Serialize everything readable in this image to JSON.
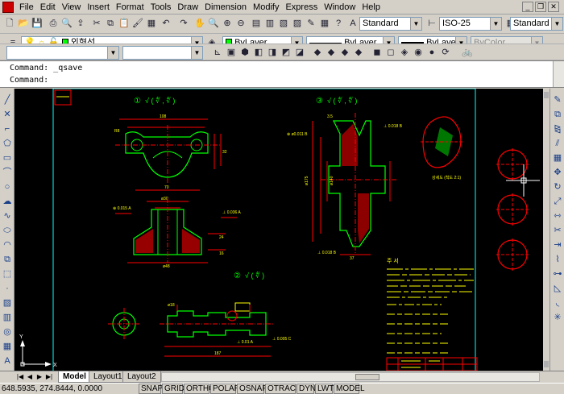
{
  "menu": {
    "items": [
      {
        "label": "File"
      },
      {
        "label": "Edit"
      },
      {
        "label": "View"
      },
      {
        "label": "Insert"
      },
      {
        "label": "Format"
      },
      {
        "label": "Tools"
      },
      {
        "label": "Draw"
      },
      {
        "label": "Dimension"
      },
      {
        "label": "Modify"
      },
      {
        "label": "Express"
      },
      {
        "label": "Window"
      },
      {
        "label": "Help"
      }
    ]
  },
  "styles": {
    "text_style": "Standard",
    "dim_style": "ISO-25",
    "table_style": "Standard"
  },
  "layers": {
    "current_layer": "외형선",
    "color": "ByLayer",
    "linetype": "ByLayer",
    "lineweight": "ByLayer",
    "plot_style": "ByColor"
  },
  "command": {
    "line1": "Command: _qsave",
    "line2": "Command:"
  },
  "drawing": {
    "view1_label": "①",
    "view2_label": "②",
    "view3_label": "③",
    "notes_title": "주 서",
    "grid_colors": {
      "outline": "#00ff00",
      "dimension": "#ff0000",
      "center": "#ff0000",
      "text": "#ffff00",
      "border": "#00ffff"
    }
  },
  "tabs": {
    "model": "Model",
    "layout1": "Layout1",
    "layout2": "Layout2"
  },
  "status": {
    "coords": "648.5935, 274.8444, 0.0000",
    "buttons": [
      "SNAP",
      "GRID",
      "ORTHO",
      "POLAR",
      "OSNAP",
      "OTRACK",
      "DYN",
      "LWT",
      "MODEL"
    ]
  },
  "colors": {
    "ui_bg": "#d4d0c8",
    "canvas_bg": "#000000"
  }
}
